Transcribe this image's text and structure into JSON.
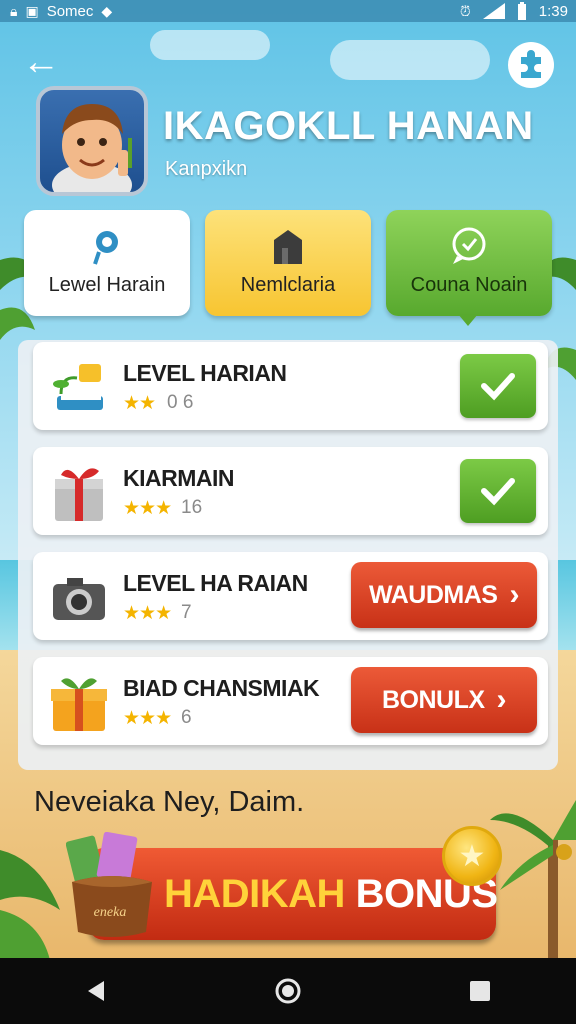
{
  "status_bar": {
    "carrier": "Somec",
    "time": "1:39",
    "icons": [
      "lock-icon",
      "image-icon",
      "diamond-icon",
      "alarm-icon",
      "signal-icon",
      "battery-icon"
    ]
  },
  "header": {
    "back_icon": "arrow-left-icon",
    "settings_icon": "puzzle-icon"
  },
  "profile": {
    "name": "IKAGOKLL HANAN",
    "subtitle": "Kanpxikn"
  },
  "tabs": [
    {
      "label": "Lewel Harain",
      "icon": "gear-icon",
      "color": "#ffffff"
    },
    {
      "label": "Nemlclaria",
      "icon": "building-icon",
      "color": "#f7c531"
    },
    {
      "label": "Couna Noain",
      "icon": "chat-icon",
      "color": "#58a92e",
      "selected": true
    }
  ],
  "rows": [
    {
      "title": "LEVEL HARIAN",
      "stars": "★★",
      "score": "0 6",
      "icon": "book-plant-icon",
      "action": "check"
    },
    {
      "title": "KIARMAIN",
      "stars": "★★★",
      "score": "16",
      "icon": "gift-icon",
      "action": "check"
    },
    {
      "title": "LEVEL HA RAIAN",
      "stars": "★★★",
      "score": "7",
      "icon": "camera-icon",
      "action": "button",
      "button_label": "WAUDMAS"
    },
    {
      "title": "BIAD CHANSMIAK",
      "stars": "★★★",
      "score": "6",
      "icon": "gift-box-icon",
      "action": "button",
      "button_label": "BONULX"
    }
  ],
  "footer_note": "Neveiaka Ney, Daim.",
  "bonus": {
    "label_highlight": "HADIKAH",
    "label_rest": "BONUS",
    "bag_text": "eneka"
  },
  "colors": {
    "check_green": "#58a92e",
    "action_red": "#d23a1c",
    "star_gold": "#f4b400",
    "highlight_yellow": "#ffd23a"
  }
}
